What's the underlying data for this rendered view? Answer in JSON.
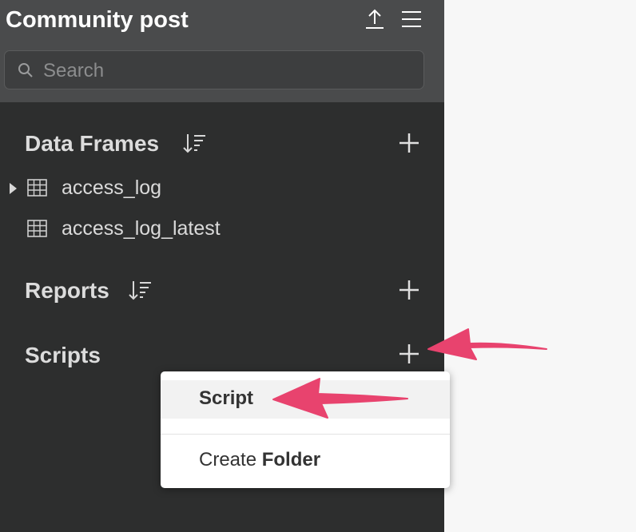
{
  "header": {
    "title": "Community post",
    "icons": {
      "upload": "upload-icon",
      "menu": "hamburger-menu-icon"
    }
  },
  "search": {
    "placeholder": "Search",
    "value": ""
  },
  "sections": {
    "data_frames": {
      "title": "Data Frames",
      "items": [
        "access_log",
        "access_log_latest"
      ]
    },
    "reports": {
      "title": "Reports"
    },
    "scripts": {
      "title": "Scripts"
    }
  },
  "context_menu": {
    "script_label": "Script",
    "create_prefix": "Create",
    "create_bold": "Folder"
  },
  "colors": {
    "sidebar_bg": "#2d2e2e",
    "header_bg": "#4a4b4c",
    "annotation_arrow": "#e8436e",
    "right_panel_bg": "#f7f7f7"
  }
}
